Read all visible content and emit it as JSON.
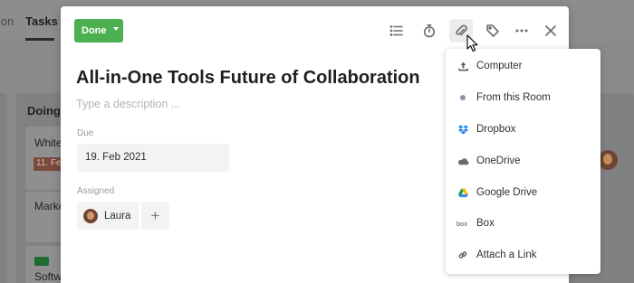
{
  "background": {
    "tab_prev": "ion",
    "tab_active": "Tasks",
    "column_title": "Doing(",
    "card1_text": "White",
    "card1_date": "11. Fe",
    "card2_text": "Marke",
    "card3_text": "Softw",
    "more_label": "..."
  },
  "modal": {
    "status_button": "Done",
    "title": "All-in-One Tools Future of Collaboration",
    "description_placeholder": "Type a description ...",
    "due_label": "Due",
    "due_value": "19. Feb 2021",
    "assigned_label": "Assigned",
    "assignee_name": "Laura",
    "add_assignee": "+"
  },
  "attach_menu": {
    "items": [
      {
        "label": "Computer",
        "icon": "upload-icon"
      },
      {
        "label": "From this Room",
        "icon": "dot-icon"
      },
      {
        "label": "Dropbox",
        "icon": "dropbox-icon"
      },
      {
        "label": "OneDrive",
        "icon": "onedrive-icon"
      },
      {
        "label": "Google Drive",
        "icon": "google-drive-icon"
      },
      {
        "label": "Box",
        "icon": "box-icon"
      },
      {
        "label": "Attach a Link",
        "icon": "link-icon"
      }
    ]
  },
  "colors": {
    "done_green": "#4caf50",
    "dropbox_blue": "#1e88e5",
    "text_dark": "#1f1f1f",
    "placeholder": "#b4b4b4"
  }
}
